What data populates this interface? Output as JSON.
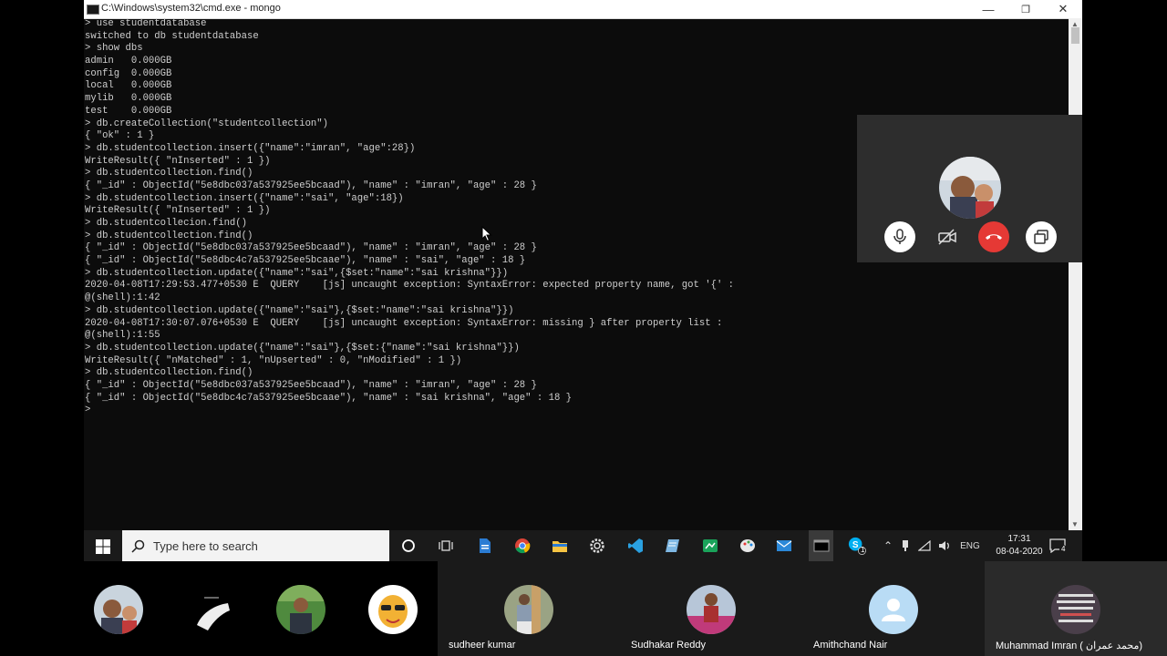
{
  "window": {
    "title": "C:\\Windows\\system32\\cmd.exe - mongo",
    "minimize_glyph": "—",
    "maximize_glyph": "❐",
    "close_glyph": "✕"
  },
  "console": {
    "lines": [
      "> use studentdatabase",
      "switched to db studentdatabase",
      "> show dbs",
      "admin   0.000GB",
      "config  0.000GB",
      "local   0.000GB",
      "mylib   0.000GB",
      "test    0.000GB",
      "> db.createCollection(\"studentcollection\")",
      "{ \"ok\" : 1 }",
      "> db.studentcollection.insert({\"name\":\"imran\", \"age\":28})",
      "WriteResult({ \"nInserted\" : 1 })",
      "> db.studentcollection.find()",
      "{ \"_id\" : ObjectId(\"5e8dbc037a537925ee5bcaad\"), \"name\" : \"imran\", \"age\" : 28 }",
      "> db.studentcollection.insert({\"name\":\"sai\", \"age\":18})",
      "WriteResult({ \"nInserted\" : 1 })",
      "> db.studentcollecion.find()",
      "> db.studentcollection.find()",
      "{ \"_id\" : ObjectId(\"5e8dbc037a537925ee5bcaad\"), \"name\" : \"imran\", \"age\" : 28 }",
      "{ \"_id\" : ObjectId(\"5e8dbc4c7a537925ee5bcaae\"), \"name\" : \"sai\", \"age\" : 18 }",
      "> db.studentcollection.update({\"name\":\"sai\",{$set:\"name\":\"sai krishna\"}})",
      "2020-04-08T17:29:53.477+0530 E  QUERY    [js] uncaught exception: SyntaxError: expected property name, got '{' :",
      "@(shell):1:42",
      "> db.studentcollection.update({\"name\":\"sai\"},{$set:\"name\":\"sai krishna\"}})",
      "2020-04-08T17:30:07.076+0530 E  QUERY    [js] uncaught exception: SyntaxError: missing } after property list :",
      "@(shell):1:55",
      "> db.studentcollection.update({\"name\":\"sai\"},{$set:{\"name\":\"sai krishna\"}})",
      "WriteResult({ \"nMatched\" : 1, \"nUpserted\" : 0, \"nModified\" : 1 })",
      "> db.studentcollection.find()",
      "{ \"_id\" : ObjectId(\"5e8dbc037a537925ee5bcaad\"), \"name\" : \"imran\", \"age\" : 28 }",
      "{ \"_id\" : ObjectId(\"5e8dbc4c7a537925ee5bcaae\"), \"name\" : \"sai krishna\", \"age\" : 18 }",
      ">"
    ]
  },
  "taskbar": {
    "search_placeholder": "Type here to search",
    "language": "ENG",
    "time": "17:31",
    "date": "08-04-2020",
    "notification_count": "4",
    "skype_badge": "1"
  },
  "participants": [
    {
      "name": ""
    },
    {
      "name": ""
    },
    {
      "name": ""
    },
    {
      "name": ""
    },
    {
      "name": "sudheer kumar"
    },
    {
      "name": "Sudhakar Reddy"
    },
    {
      "name": "Amithchand Nair"
    },
    {
      "name": "Muhammad Imran ( محمد  عمران)"
    }
  ],
  "colors": {
    "console_bg": "#0c0c0c",
    "console_text": "#cfcfcf",
    "end_call": "#e53935",
    "call_panel": "#2d2d2d",
    "avatar_default": "#b9dcf5"
  }
}
